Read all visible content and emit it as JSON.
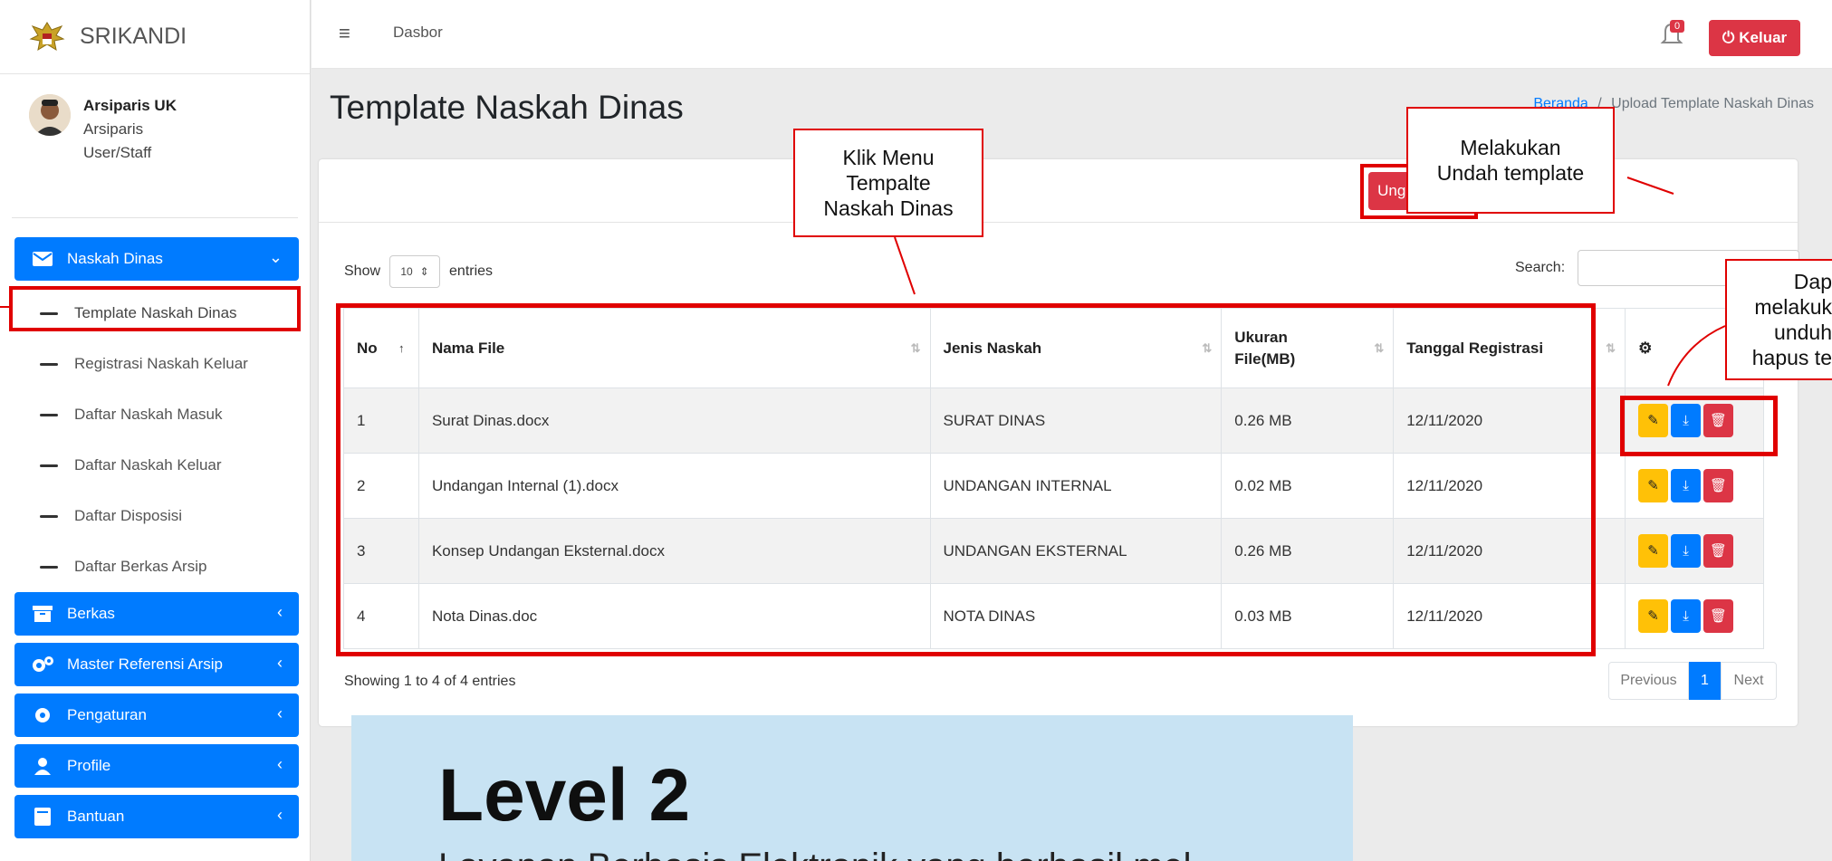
{
  "app": {
    "name": "SRIKANDI"
  },
  "user": {
    "name": "Arsiparis UK",
    "role": "Arsiparis",
    "type": "User/Staff"
  },
  "sidebar": {
    "naskah_dinas": "Naskah Dinas",
    "submenu": [
      "Template Naskah Dinas",
      "Registrasi Naskah Keluar",
      "Daftar Naskah Masuk",
      "Daftar Naskah Keluar",
      "Daftar Disposisi",
      "Daftar Berkas Arsip"
    ],
    "menus": [
      "Berkas",
      "Master Referensi Arsip",
      "Pengaturan",
      "Profile",
      "Bantuan"
    ]
  },
  "topbar": {
    "breadcrumb_home": "Dasbor",
    "notif_count": "0",
    "logout_label": "Keluar"
  },
  "page": {
    "title": "Template Naskah Dinas",
    "bc_home": "Beranda",
    "bc_sep": "/",
    "bc_current": "Upload Template Naskah Dinas",
    "upload_label": "Unggah File"
  },
  "table": {
    "show_label": "Show",
    "entries_value": "10",
    "entries_label": "entries",
    "search_label": "Search:",
    "columns": [
      "No",
      "Nama File",
      "Jenis Naskah",
      "Ukuran File(MB)",
      "Tanggal Registrasi"
    ],
    "rows": [
      {
        "no": "1",
        "file": "Surat Dinas.docx",
        "jenis": "SURAT DINAS",
        "size": "0.26 MB",
        "date": "12/11/2020"
      },
      {
        "no": "2",
        "file": "Undangan Internal (1).docx",
        "jenis": "UNDANGAN INTERNAL",
        "size": "0.02 MB",
        "date": "12/11/2020"
      },
      {
        "no": "3",
        "file": "Konsep Undangan Eksternal.docx",
        "jenis": "UNDANGAN EKSTERNAL",
        "size": "0.26 MB",
        "date": "12/11/2020"
      },
      {
        "no": "4",
        "file": "Nota Dinas.doc",
        "jenis": "NOTA DINAS",
        "size": "0.03 MB",
        "date": "12/11/2020"
      }
    ],
    "showing": "Showing 1 to 4 of 4 entries",
    "prev": "Previous",
    "page": "1",
    "next": "Next"
  },
  "callouts": {
    "menu": [
      "Klik Menu",
      "Tempalte",
      "Naskah Dinas"
    ],
    "upload": [
      "Melakukan",
      "Undah template"
    ],
    "actions": [
      "Dap",
      "melakuk",
      "unduh",
      "hapus te"
    ]
  },
  "overlay": {
    "title": "Level 2",
    "subtitle": "Layanan Berbasis Elektronik yang berhasil mel"
  },
  "colors": {
    "primary": "#007bff",
    "danger": "#dc3545",
    "warning": "#ffc107",
    "highlight": "#e00000",
    "overlay": "#c8e3f3"
  }
}
